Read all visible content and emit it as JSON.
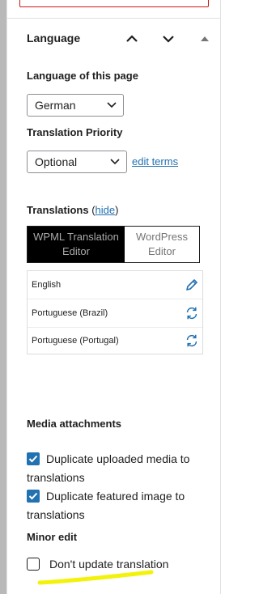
{
  "panel": {
    "title": "Language"
  },
  "language_of_page": {
    "label": "Language of this page",
    "selected": "German"
  },
  "translation_priority": {
    "label": "Translation Priority",
    "selected": "Optional",
    "edit_terms_link": "edit terms"
  },
  "translations": {
    "label": "Translations",
    "hide_open": "(",
    "hide_link": "hide",
    "hide_close": ")",
    "tabs": [
      {
        "label": "WPML Translation Editor",
        "active": true
      },
      {
        "label": "WordPress Editor",
        "active": false
      }
    ],
    "languages": [
      {
        "name": "English",
        "action_icon": "pencil-icon"
      },
      {
        "name": "Portuguese (Brazil)",
        "action_icon": "refresh-icon"
      },
      {
        "name": "Portuguese (Portugal)",
        "action_icon": "refresh-icon"
      }
    ]
  },
  "media": {
    "label": "Media attachments",
    "options": [
      {
        "line1": "Duplicate uploaded media to",
        "line2": "translations",
        "checked": true
      },
      {
        "line1": "Duplicate featured image to",
        "line2": "translations",
        "checked": true
      }
    ]
  },
  "minor_edit": {
    "label": "Minor edit",
    "option": {
      "text": "Don't update translation",
      "checked": false
    }
  },
  "colors": {
    "link": "#2271b1",
    "checkbox": "#2271b1",
    "active_tab_bg": "#000000",
    "highlight": "#f2f20a",
    "error_border": "#cc1818"
  }
}
